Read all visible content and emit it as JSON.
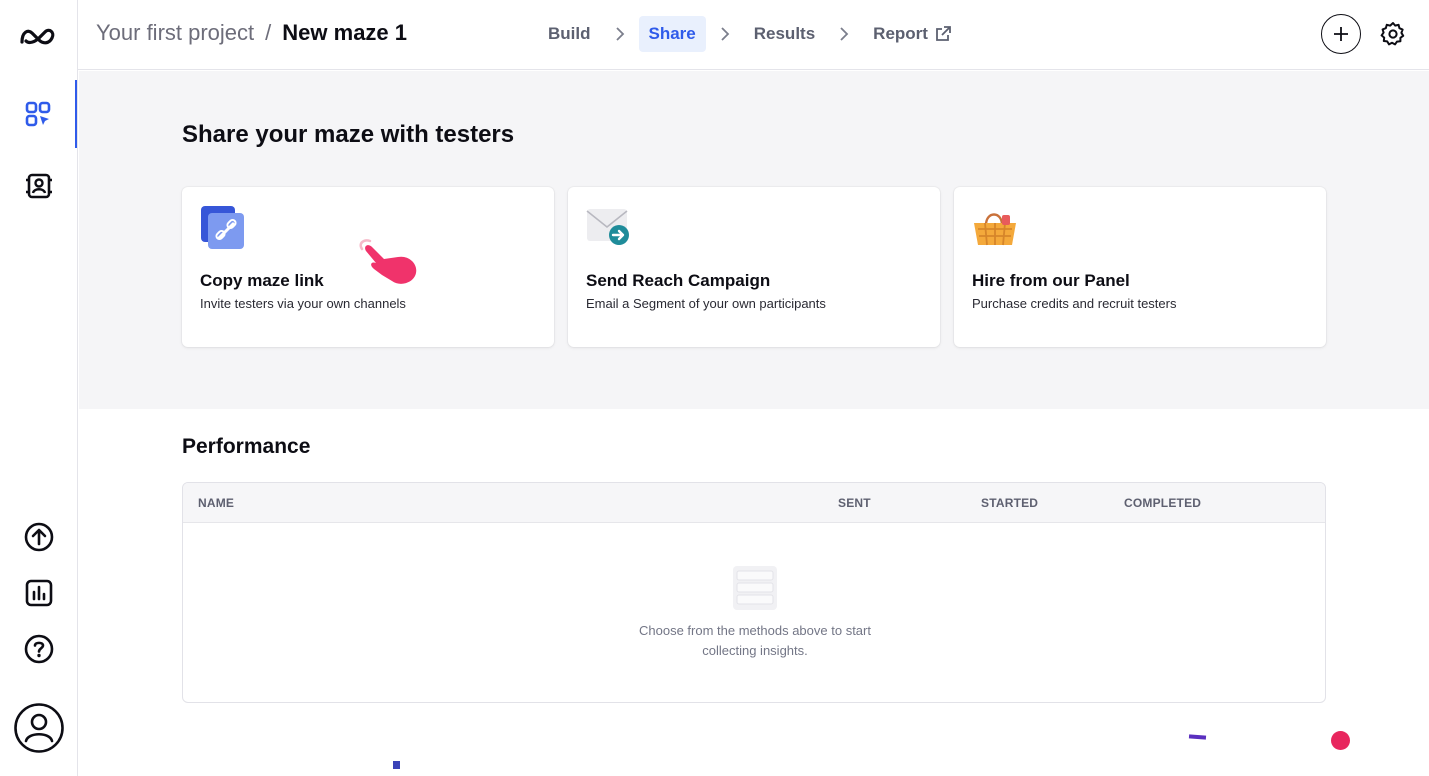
{
  "header": {
    "project": "Your first project",
    "separator": "/",
    "maze": "New maze 1",
    "steps": [
      "Build",
      "Share",
      "Results",
      "Report"
    ],
    "active_step": "Share"
  },
  "share": {
    "title": "Share your maze with testers",
    "cards": [
      {
        "title": "Copy maze link",
        "desc": "Invite testers via your own channels",
        "icon": "link-icon"
      },
      {
        "title": "Send Reach Campaign",
        "desc": "Email a Segment of your own participants",
        "icon": "mail-send-icon"
      },
      {
        "title": "Hire from our Panel",
        "desc": "Purchase credits and recruit testers",
        "icon": "basket-icon"
      }
    ]
  },
  "performance": {
    "title": "Performance",
    "columns": [
      "NAME",
      "SENT",
      "STARTED",
      "COMPLETED"
    ],
    "empty_line1": "Choose from the methods above to start",
    "empty_line2": "collecting insights."
  },
  "colors": {
    "accent": "#2f5bea",
    "active_tab_bg": "#e9f0fd",
    "section_bg": "#f5f5f7",
    "cursor_pink": "#f0336b"
  }
}
